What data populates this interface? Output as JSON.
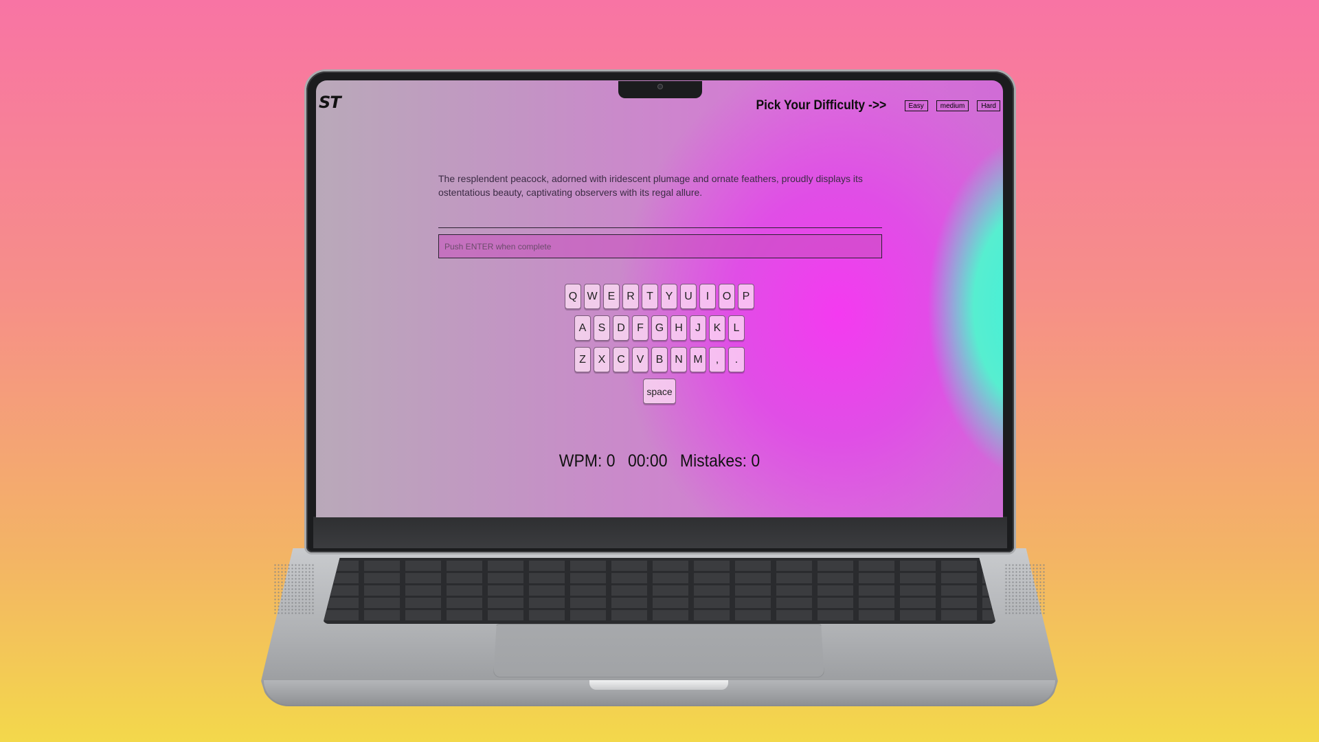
{
  "app": {
    "logo": "ST"
  },
  "header": {
    "pick_label": "Pick Your Difficulty ->>",
    "difficulties": [
      "Easy",
      "medium",
      "Hard"
    ]
  },
  "prompt": {
    "sentence": "The resplendent peacock, adorned with iridescent plumage and ornate feathers, proudly displays its ostentatious beauty, captivating observers with its regal allure."
  },
  "input": {
    "value": "",
    "placeholder": "Push ENTER when complete"
  },
  "keyboard": {
    "row1": [
      "Q",
      "W",
      "E",
      "R",
      "T",
      "Y",
      "U",
      "I",
      "O",
      "P"
    ],
    "row2": [
      "A",
      "S",
      "D",
      "F",
      "G",
      "H",
      "J",
      "K",
      "L"
    ],
    "row3": [
      "Z",
      "X",
      "C",
      "V",
      "B",
      "N",
      "M",
      ",",
      "."
    ],
    "space": "space"
  },
  "stats": {
    "wpm": "WPM: 0",
    "timer": "00:00",
    "mistakes": "Mistakes: 0"
  },
  "colors": {
    "background_top": "#f874a4",
    "background_bottom": "#f3d84b",
    "screen_magenta": "#f43af0",
    "screen_cyan": "#3ef0da"
  }
}
